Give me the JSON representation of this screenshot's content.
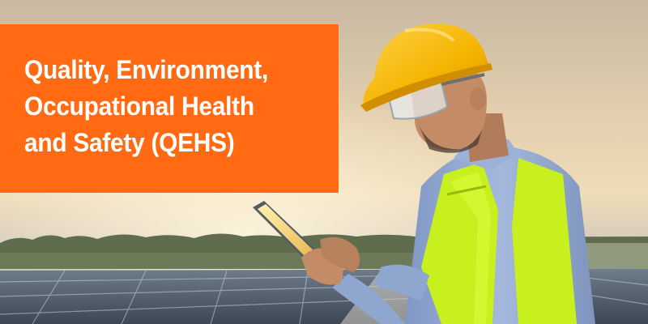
{
  "headline": {
    "lines": [
      "Quality, Environment,",
      "Occupational Health",
      "and Safety (QEHS)"
    ]
  },
  "colors": {
    "title_background": "#ff6a13",
    "title_text": "#ffffff",
    "hard_hat": "#f4b400",
    "safety_vest": "#c8f01e",
    "shirt": "#8fa6cf"
  },
  "photo": {
    "subject": "engineer in hard hat and safety vest holding a tablet on a solar panel rooftop at sunset"
  }
}
